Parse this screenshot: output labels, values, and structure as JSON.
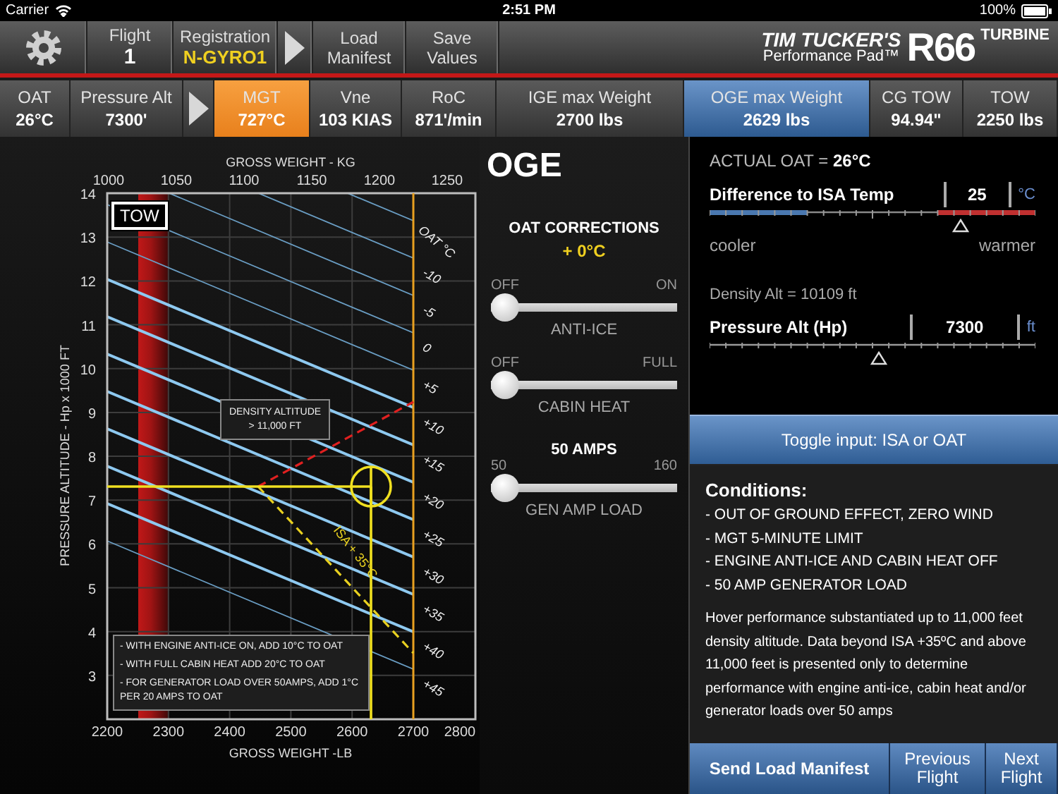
{
  "status_bar": {
    "carrier": "Carrier",
    "time": "2:51 PM",
    "battery": "100%"
  },
  "toolbar": {
    "flight_label": "Flight",
    "flight": "1",
    "registration_label": "Registration",
    "registration": "N-GYRO1",
    "buttons": [
      "Load Manifest",
      "Save Values"
    ],
    "logo": {
      "line_1": "TIM TUCKER'S",
      "line_2": "Performance Pad™",
      "model": "R66",
      "variant": "TURBINE"
    }
  },
  "readouts": [
    {
      "kind": "value",
      "label": "OAT",
      "value": "26°C",
      "selected": false,
      "alert": false
    },
    {
      "kind": "value",
      "label": "Pressure Alt",
      "value": "7300'",
      "selected": false,
      "alert": false
    },
    {
      "kind": "arrow",
      "selected": false
    },
    {
      "kind": "value",
      "label": "MGT",
      "value": "727°C",
      "selected": false,
      "alert": true
    },
    {
      "kind": "value",
      "label": "Vne",
      "value": "103 KIAS",
      "selected": false,
      "alert": false
    },
    {
      "kind": "value",
      "label": "RoC",
      "value": "871'/min",
      "selected": false,
      "alert": false
    },
    {
      "kind": "value",
      "label": "IGE max Weight",
      "value": "2700 lbs",
      "selected": false,
      "alert": false
    },
    {
      "kind": "value",
      "label": "OGE max Weight",
      "value": "2629 lbs",
      "selected": true,
      "alert": false
    },
    {
      "kind": "value",
      "label": "CG TOW",
      "value": "94.94\"",
      "selected": false,
      "alert": false
    },
    {
      "kind": "value",
      "label": "TOW",
      "value": "2250 lbs",
      "selected": false,
      "alert": false
    }
  ],
  "chart": {
    "badge": "TOW",
    "top_axis_title": "GROSS WEIGHT - KG",
    "top_ticks": [
      "1000",
      "1050",
      "1100",
      "1150",
      "1200",
      "1250"
    ],
    "left_axis_title": "PRESSURE ALTITUDE - Hp x 1000 FT",
    "left_ticks": [
      "14",
      "13",
      "12",
      "11",
      "10",
      "9",
      "8",
      "7",
      "6",
      "5",
      "4",
      "3"
    ],
    "bottom_ticks": [
      "2200",
      "2300",
      "2400",
      "2500",
      "2600",
      "2700",
      "2800"
    ],
    "bottom_axis_title": "GROSS WEIGHT -LB",
    "oat_title": "OAT °C",
    "oat_ticks": [
      "-10",
      "-5",
      "0",
      "+5",
      "+10",
      "+15",
      "+20",
      "+25",
      "+30",
      "+35",
      "+40",
      "+45"
    ],
    "density_note": [
      "DENSITY ALTITUDE",
      "> 11,000 FT"
    ],
    "isa_label": "ISA + 35°C",
    "notes": [
      "- WITH ENGINE ANTI-ICE ON, ADD 10°C TO OAT",
      "- WITH FULL CABIN HEAT ADD 20°C TO OAT",
      "- FOR GENERATOR LOAD OVER 50AMPS, ADD 1°C PER 20 AMPS TO OAT"
    ]
  },
  "corrections": {
    "title": "OGE",
    "heading": "OAT CORRECTIONS",
    "total": "+ 0°C",
    "sliders": [
      {
        "min_label": "OFF",
        "max_label": "ON",
        "name": "ANTI-ICE",
        "level": 0
      },
      {
        "min_label": "OFF",
        "max_label": "FULL",
        "name": "CABIN HEAT",
        "level": 0
      },
      {
        "value": "50 AMPS",
        "min_label": "50",
        "max_label": "160",
        "name": "GEN AMP LOAD",
        "level": 0
      }
    ]
  },
  "isa": {
    "actual_oat": "ACTUAL OAT = **26°C**",
    "label": "Difference to ISA Temp",
    "value": "25",
    "unit": "°C",
    "level": 0.77,
    "low_label": "cooler",
    "high_label": "warmer"
  },
  "pressure": {
    "density_alt": "Density Alt =  10109 ft",
    "label": "Pressure Alt (Hp)",
    "value": "7300",
    "unit": "ft",
    "level": 0.52
  },
  "toggle_button": "Toggle input: ISA or OAT",
  "conditions": {
    "title": "Conditions:",
    "items": [
      "- OUT OF GROUND EFFECT, ZERO WIND",
      "- MGT 5-MINUTE LIMIT",
      "- ENGINE ANTI-ICE AND CABIN HEAT OFF",
      "- 50 AMP GENERATOR LOAD"
    ],
    "note": "Hover performance substantiated up to 11,000 feet density altitude. Data beyond ISA +35ºC and above 11,000 feet is presented only to determine performance with engine anti-ice, cabin heat and/or generator loads over 50 amps"
  },
  "footer_buttons": [
    "Send Load Manifest",
    "Previous Flight",
    "Next Flight"
  ]
}
